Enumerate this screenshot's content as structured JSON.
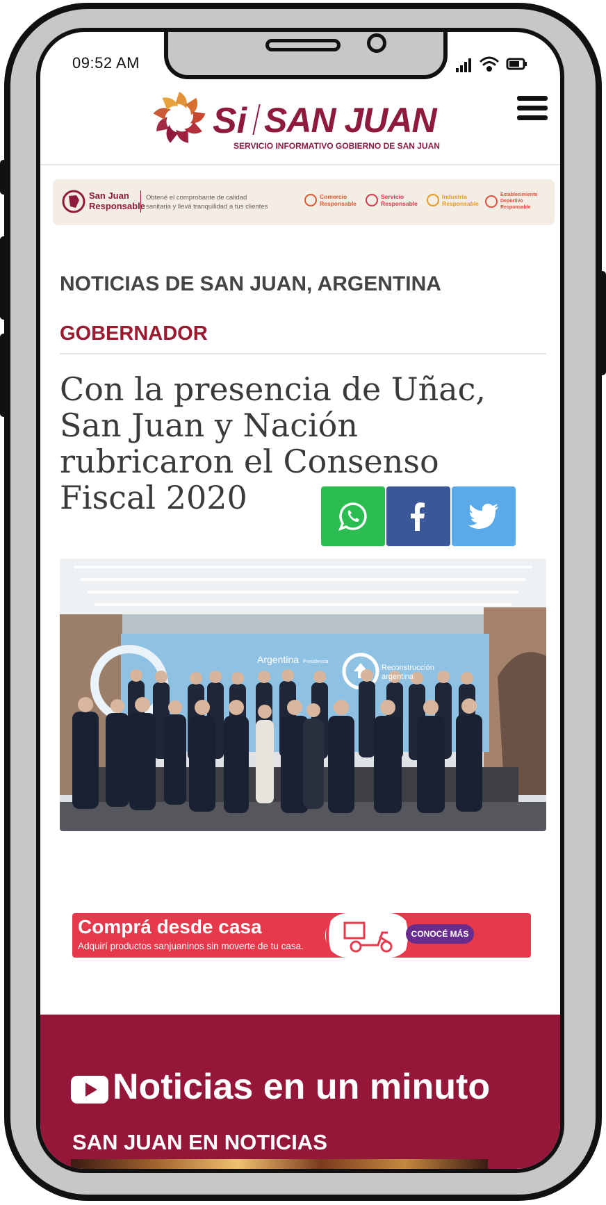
{
  "status_bar": {
    "time": "09:52 AM"
  },
  "header": {
    "logo_si": "Si",
    "logo_main": "SAN JUAN",
    "logo_subtitle": "SERVICIO INFORMATIVO GOBIERNO DE SAN JUAN",
    "menu_icon": "hamburger-menu-icon"
  },
  "top_banner": {
    "brand_line1": "San Juan",
    "brand_line2": "Responsable",
    "message_line1": "Obtené el comprobante de calidad",
    "message_line2": "sanitaria y llevá tranquilidad a tus clientes",
    "badges": [
      {
        "line1": "Comercio",
        "line2": "Responsable",
        "color": "#e0572e"
      },
      {
        "line1": "Servicio",
        "line2": "Responsable",
        "color": "#d9364c"
      },
      {
        "line1": "Industria",
        "line2": "Responsable",
        "color": "#e89a1c"
      },
      {
        "line1": "Establecimiento",
        "line2": "Deportivo Responsable",
        "color": "#e24d3d"
      }
    ]
  },
  "section_title": "NOTICIAS DE SAN JUAN, ARGENTINA",
  "article": {
    "category": "GOBERNADOR",
    "headline": "Con la presencia de Uñac, San Juan y Nación rubricaron el Consenso Fiscal 2020",
    "photo_backdrop_left": "Argentina",
    "photo_backdrop_left_small": "Presidencia",
    "photo_backdrop_right_line1": "Reconstrucción",
    "photo_backdrop_right_line2": "argentina"
  },
  "share_buttons": [
    {
      "name": "whatsapp",
      "icon": "whatsapp-icon",
      "color": "#2bbd52"
    },
    {
      "name": "facebook",
      "icon": "facebook-icon",
      "color": "#3a5897"
    },
    {
      "name": "twitter",
      "icon": "twitter-icon",
      "color": "#5aaae9"
    }
  ],
  "promo_banner": {
    "title": "Comprá desde casa",
    "subtitle": "Adquirí productos sanjuaninos sin moverte de tu casa.",
    "cta": "CONOCÉ MÁS"
  },
  "video_section": {
    "title": "Noticias en un minuto",
    "subtitle": "SAN JUAN EN NOTICIAS",
    "icon": "youtube-play-icon"
  },
  "colors": {
    "brand": "#941739",
    "category": "#9b1a30",
    "promo": "#e63a4c",
    "cta": "#6a2c8c"
  }
}
